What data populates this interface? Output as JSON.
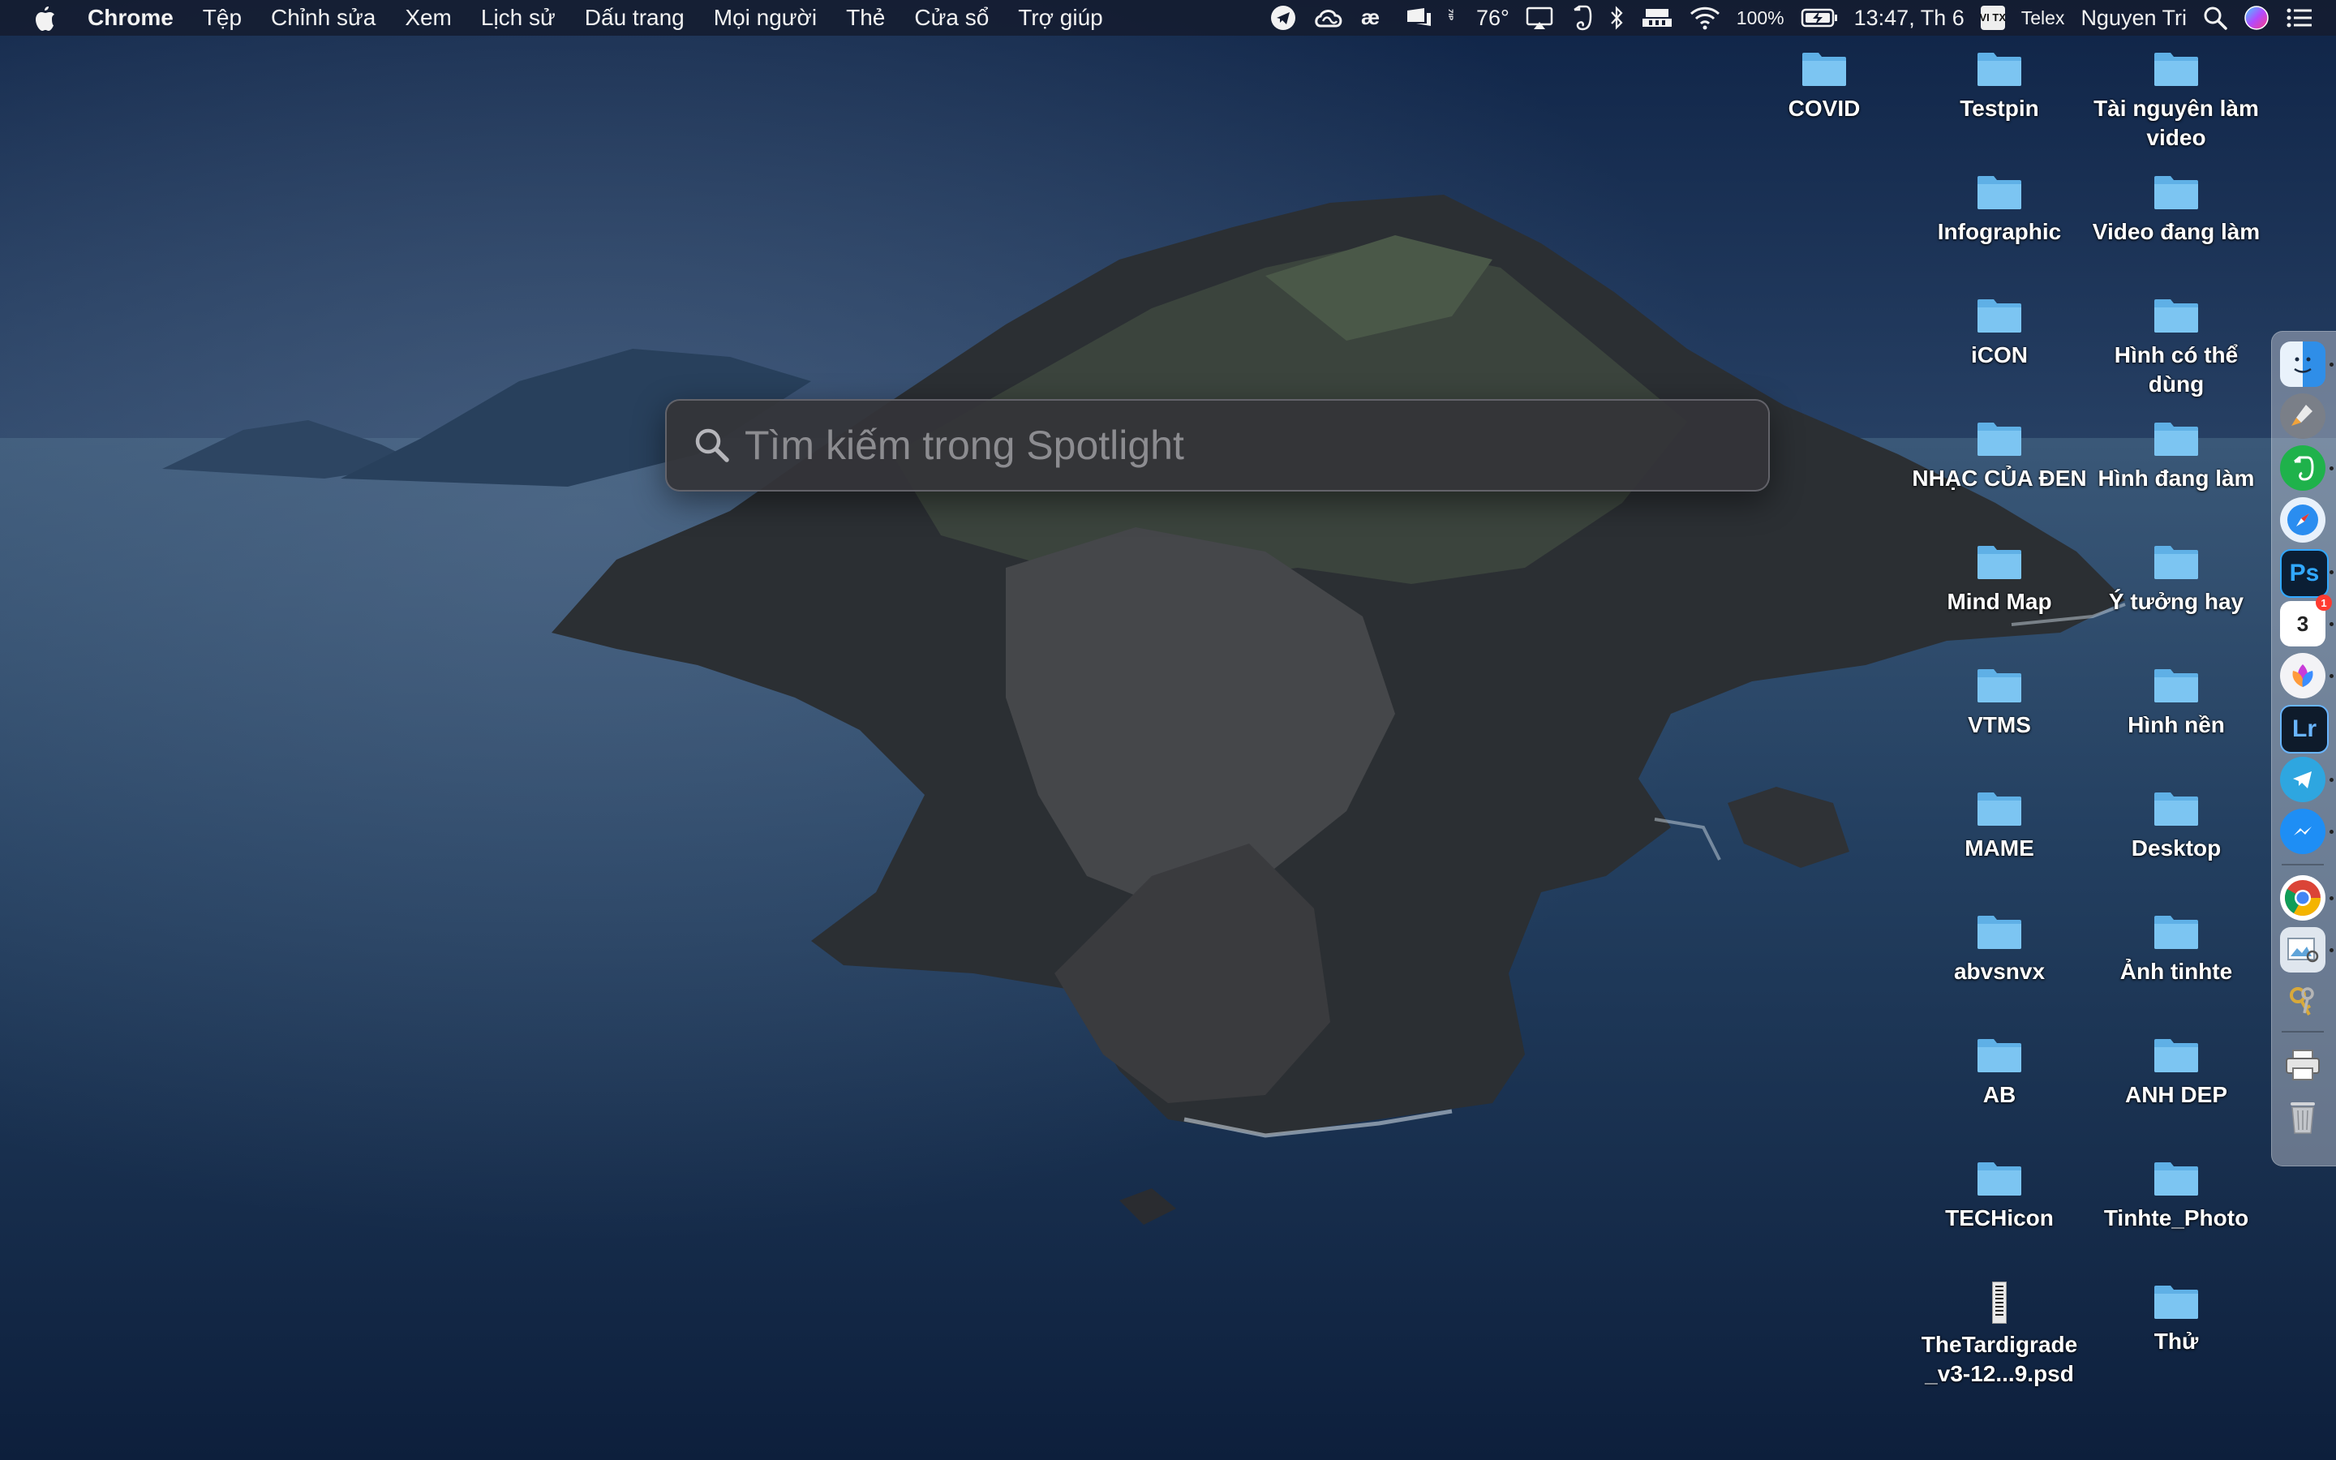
{
  "menubar": {
    "apple_icon": "apple-icon",
    "app_name": "Chrome",
    "items": [
      "Tệp",
      "Chỉnh sửa",
      "Xem",
      "Lịch sử",
      "Dấu trang",
      "Mọi người",
      "Thẻ",
      "Cửa sổ",
      "Trợ giúp"
    ],
    "status": {
      "zip_label": "ZIP",
      "temperature": "76°",
      "battery": "100%",
      "datetime": "13:47, Th 6",
      "input_badge": "VI TX",
      "input_method": "Telex",
      "user": "Nguyen Tri"
    }
  },
  "spotlight": {
    "placeholder": "Tìm kiếm trong Spotlight",
    "value": ""
  },
  "desktop": {
    "icons": [
      {
        "label": "COVID",
        "type": "folder"
      },
      {
        "label": "Testpin",
        "type": "folder"
      },
      {
        "label": "Tài nguyên làm video",
        "type": "folder"
      },
      {
        "label": "Infographic",
        "type": "folder"
      },
      {
        "label": "Video đang làm",
        "type": "folder"
      },
      {
        "label": "iCON",
        "type": "folder"
      },
      {
        "label": "Hình có thể dùng",
        "type": "folder"
      },
      {
        "label": "NHẠC CỦA ĐEN",
        "type": "folder"
      },
      {
        "label": "Hình đang làm",
        "type": "folder"
      },
      {
        "label": "Mind Map",
        "type": "folder"
      },
      {
        "label": "Ý tưởng hay",
        "type": "folder"
      },
      {
        "label": "VTMS",
        "type": "folder"
      },
      {
        "label": "Hình nền",
        "type": "folder"
      },
      {
        "label": "MAME",
        "type": "folder"
      },
      {
        "label": "Desktop",
        "type": "folder"
      },
      {
        "label": "abvsnvx",
        "type": "folder"
      },
      {
        "label": "Ảnh tinhte",
        "type": "folder"
      },
      {
        "label": "AB",
        "type": "folder"
      },
      {
        "label": "ANH DEP",
        "type": "folder"
      },
      {
        "label": "TECHicon",
        "type": "folder"
      },
      {
        "label": "Tinhte_Photo",
        "type": "folder"
      },
      {
        "label": "TheTardigrade _v3-12...9.psd",
        "type": "file"
      },
      {
        "label": "Thử",
        "type": "folder"
      }
    ]
  },
  "dock": {
    "apps": [
      {
        "name": "finder-icon",
        "glyph": ""
      },
      {
        "name": "launchpad-icon",
        "glyph": ""
      },
      {
        "name": "evernote-icon",
        "glyph": ""
      },
      {
        "name": "safari-icon",
        "glyph": ""
      },
      {
        "name": "photoshop-icon",
        "glyph": "Ps"
      },
      {
        "name": "calendar-icon",
        "glyph": "3",
        "badge": "1"
      },
      {
        "name": "affinity-icon",
        "glyph": ""
      },
      {
        "name": "lightroom-icon",
        "glyph": "Lr"
      },
      {
        "name": "telegram-icon",
        "glyph": ""
      },
      {
        "name": "messenger-icon",
        "glyph": ""
      },
      {
        "name": "chrome-icon",
        "glyph": ""
      },
      {
        "name": "preview-icon",
        "glyph": ""
      },
      {
        "name": "keychain-icon",
        "glyph": ""
      },
      {
        "name": "printer-icon",
        "glyph": ""
      },
      {
        "name": "trash-icon",
        "glyph": ""
      }
    ]
  }
}
